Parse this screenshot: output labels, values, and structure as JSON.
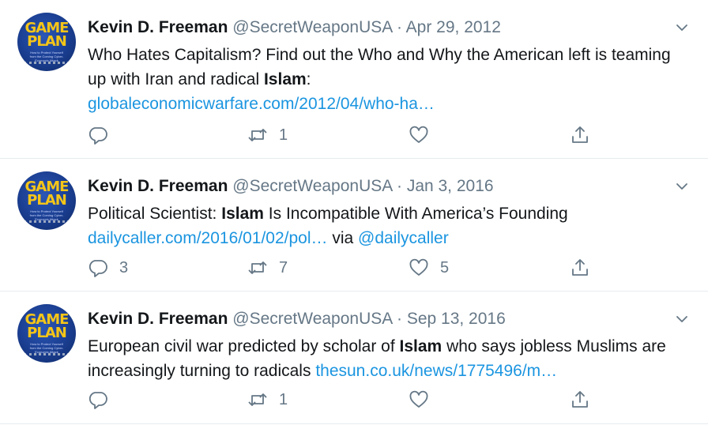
{
  "tweets": [
    {
      "name": "Kevin D. Freeman",
      "handle": "@SecretWeaponUSA",
      "separator": "·",
      "date": "Apr 29, 2012",
      "text_parts": [
        "Who Hates Capitalism? Find out the Who and Why the American left is teaming up with Iran and radical ",
        "Islam",
        ":"
      ],
      "link": "globaleconomicwarfare.com/2012/04/who-ha…",
      "reply_count": "",
      "retweet_count": "1",
      "like_count": ""
    },
    {
      "name": "Kevin D. Freeman",
      "handle": "@SecretWeaponUSA",
      "separator": "·",
      "date": "Jan 3, 2016",
      "text_parts": [
        "Political Scientist: ",
        "Islam",
        " Is Incompatible With America’s Founding"
      ],
      "link": "dailycaller.com/2016/01/02/pol…",
      "via": " via ",
      "mention": "@dailycaller",
      "reply_count": "3",
      "retweet_count": "7",
      "like_count": "5"
    },
    {
      "name": "Kevin D. Freeman",
      "handle": "@SecretWeaponUSA",
      "separator": "·",
      "date": "Sep 13, 2016",
      "text_parts": [
        "European civil war predicted by scholar of ",
        "Islam",
        " who says jobless Muslims are increasingly turning to radicals "
      ],
      "link": "thesun.co.uk/news/1775496/m…",
      "reply_count": "",
      "retweet_count": "1",
      "like_count": ""
    }
  ],
  "avatar": {
    "line1": "GAME",
    "line2": "PLAN",
    "subtitle": "How to Protect Yourself from the Coming Cyber-Economic Attack"
  },
  "icons": {
    "reply": "reply-icon",
    "retweet": "retweet-icon",
    "like": "like-icon",
    "share": "share-icon",
    "menu": "chevron-down-icon"
  },
  "colors": {
    "link": "#1b95e0",
    "secondary": "#657786",
    "avatar_text": "#f5c518",
    "avatar_bg": "#1a3d8f"
  }
}
